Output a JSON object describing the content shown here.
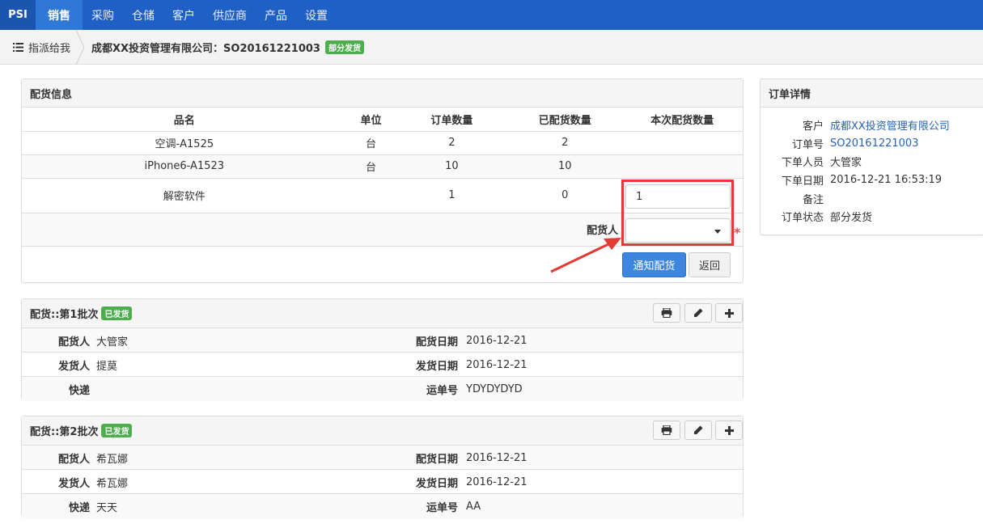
{
  "nav": {
    "brand": "PSI",
    "items": [
      {
        "label": "销售",
        "active": true
      },
      {
        "label": "采购"
      },
      {
        "label": "仓储"
      },
      {
        "label": "客户"
      },
      {
        "label": "供应商"
      },
      {
        "label": "产品"
      },
      {
        "label": "设置"
      }
    ]
  },
  "breadcrumb": {
    "first": "指派给我",
    "title": "成都XX投资管理有限公司：SO20161221003",
    "badge": "部分发货"
  },
  "distribution": {
    "title": "配货信息",
    "columns": [
      "品名",
      "单位",
      "订单数量",
      "已配货数量",
      "本次配货数量"
    ],
    "rows": [
      {
        "name": "空调-A1525",
        "unit": "台",
        "order_qty": "2",
        "distributed_qty": "2"
      },
      {
        "name": "iPhone6-A1523",
        "unit": "台",
        "order_qty": "10",
        "distributed_qty": "10"
      },
      {
        "name": "解密软件",
        "unit": "",
        "order_qty": "1",
        "distributed_qty": "0",
        "this_qty": "1"
      }
    ],
    "picker_label": "配货人",
    "picker_value": "",
    "required_mark": "*",
    "notify_button": "通知配货",
    "back_button": "返回"
  },
  "batches": [
    {
      "title": "配货::第1批次",
      "badge": "已发货",
      "distributor_label": "配货人",
      "distributor": "大管家",
      "dist_date_label": "配货日期",
      "dist_date": "2016-12-21",
      "shipper_label": "发货人",
      "shipper": "提莫",
      "ship_date_label": "发货日期",
      "ship_date": "2016-12-21",
      "courier_label": "快递",
      "courier": "",
      "tracking_label": "运单号",
      "tracking": "YDYDYDYD"
    },
    {
      "title": "配货::第2批次",
      "badge": "已发货",
      "distributor_label": "配货人",
      "distributor": "希瓦娜",
      "dist_date_label": "配货日期",
      "dist_date": "2016-12-21",
      "shipper_label": "发货人",
      "shipper": "希瓦娜",
      "ship_date_label": "发货日期",
      "ship_date": "2016-12-21",
      "courier_label": "快递",
      "courier": "天天",
      "tracking_label": "运单号",
      "tracking": "AA"
    }
  ],
  "order_detail": {
    "title": "订单详情",
    "fields": [
      {
        "label": "客户",
        "value": "成都XX投资管理有限公司"
      },
      {
        "label": "订单号",
        "value": "SO20161221003"
      },
      {
        "label": "下单人员",
        "value": "大管家"
      },
      {
        "label": "下单日期",
        "value": "2016-12-21 16:53:19"
      },
      {
        "label": "备注",
        "value": ""
      },
      {
        "label": "订单状态",
        "value": "部分发货"
      }
    ]
  },
  "colors": {
    "nav_bg": "#1f60c4",
    "nav_active": "#2f78d8",
    "badge_green": "#4cae4c",
    "primary_button": "#3c86e0",
    "annotation_red": "#e53935",
    "link": "#2a62b3"
  }
}
